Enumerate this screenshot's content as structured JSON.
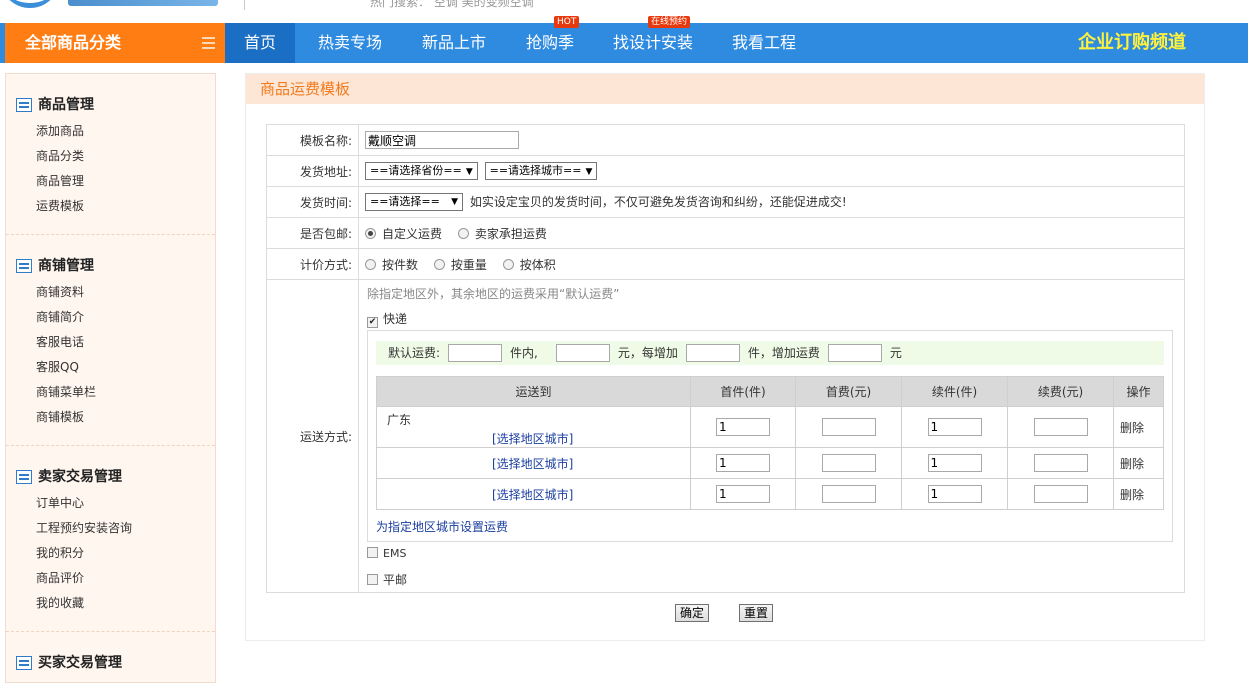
{
  "header": {
    "hot_search": "热门搜索：  空调  美的变频空调"
  },
  "nav": {
    "all_categories": "全部商品分类",
    "items": [
      {
        "label": "首页"
      },
      {
        "label": "热卖专场"
      },
      {
        "label": "新品上市"
      },
      {
        "label": "抢购季",
        "badge": "HOT"
      },
      {
        "label": "找设计安装",
        "badge": "在线预约"
      },
      {
        "label": "我看工程"
      }
    ],
    "enterprise": "企业订购频道"
  },
  "sidebar": {
    "groups": [
      {
        "title": "商品管理",
        "links": [
          "添加商品",
          "商品分类",
          "商品管理",
          "运费模板"
        ]
      },
      {
        "title": "商铺管理",
        "links": [
          "商铺资料",
          "商铺简介",
          "客服电话",
          "客服QQ",
          "商铺菜单栏",
          "商铺模板"
        ]
      },
      {
        "title": "卖家交易管理",
        "links": [
          "订单中心",
          "工程预约安装咨询",
          "我的积分",
          "商品评价",
          "我的收藏"
        ]
      },
      {
        "title": "买家交易管理",
        "links": []
      }
    ]
  },
  "panel": {
    "title": "商品运费模板",
    "form": {
      "template_name_label": "模板名称:",
      "template_name_value": "戴顺空调",
      "address_label": "发货地址:",
      "province_select": "==请选择省份==",
      "city_select": "==请选择城市==",
      "time_label": "发货时间:",
      "time_select": "==请选择==",
      "time_hint": "如实设定宝贝的发货时间，不仅可避免发货咨询和纠纷，还能促进成交!",
      "free_label": "是否包邮:",
      "free_options": [
        "自定义运费",
        "卖家承担运费"
      ],
      "pricing_label": "计价方式:",
      "pricing_options": [
        "按件数",
        "按重量",
        "按体积"
      ],
      "shipping_label": "运送方式:",
      "shipping_hint": "除指定地区外，其余地区的运费采用“默认运费”",
      "express_label": "快递",
      "default_fee": {
        "prefix": "默认运费:",
        "in_units": "件内,",
        "yuan_each": "元，每增加",
        "units_add": "件，增加运费",
        "yuan": "元"
      },
      "table_headers": [
        "运送到",
        "首件(件)",
        "首费(元)",
        "续件(件)",
        "续费(元)",
        "操作"
      ],
      "rows": [
        {
          "area": "广东",
          "choose": "[选择地区城市]",
          "first_qty": "1",
          "first_fee": "",
          "next_qty": "1",
          "next_fee": "",
          "op": "删除"
        },
        {
          "area": "",
          "choose": "[选择地区城市]",
          "first_qty": "1",
          "first_fee": "",
          "next_qty": "1",
          "next_fee": "",
          "op": "删除"
        },
        {
          "area": "",
          "choose": "[选择地区城市]",
          "first_qty": "1",
          "first_fee": "",
          "next_qty": "1",
          "next_fee": "",
          "op": "删除"
        }
      ],
      "set_area_link": "为指定地区城市设置运费",
      "ems_label": "EMS",
      "mail_label": "平邮",
      "confirm": "确定",
      "reset": "重置"
    }
  }
}
